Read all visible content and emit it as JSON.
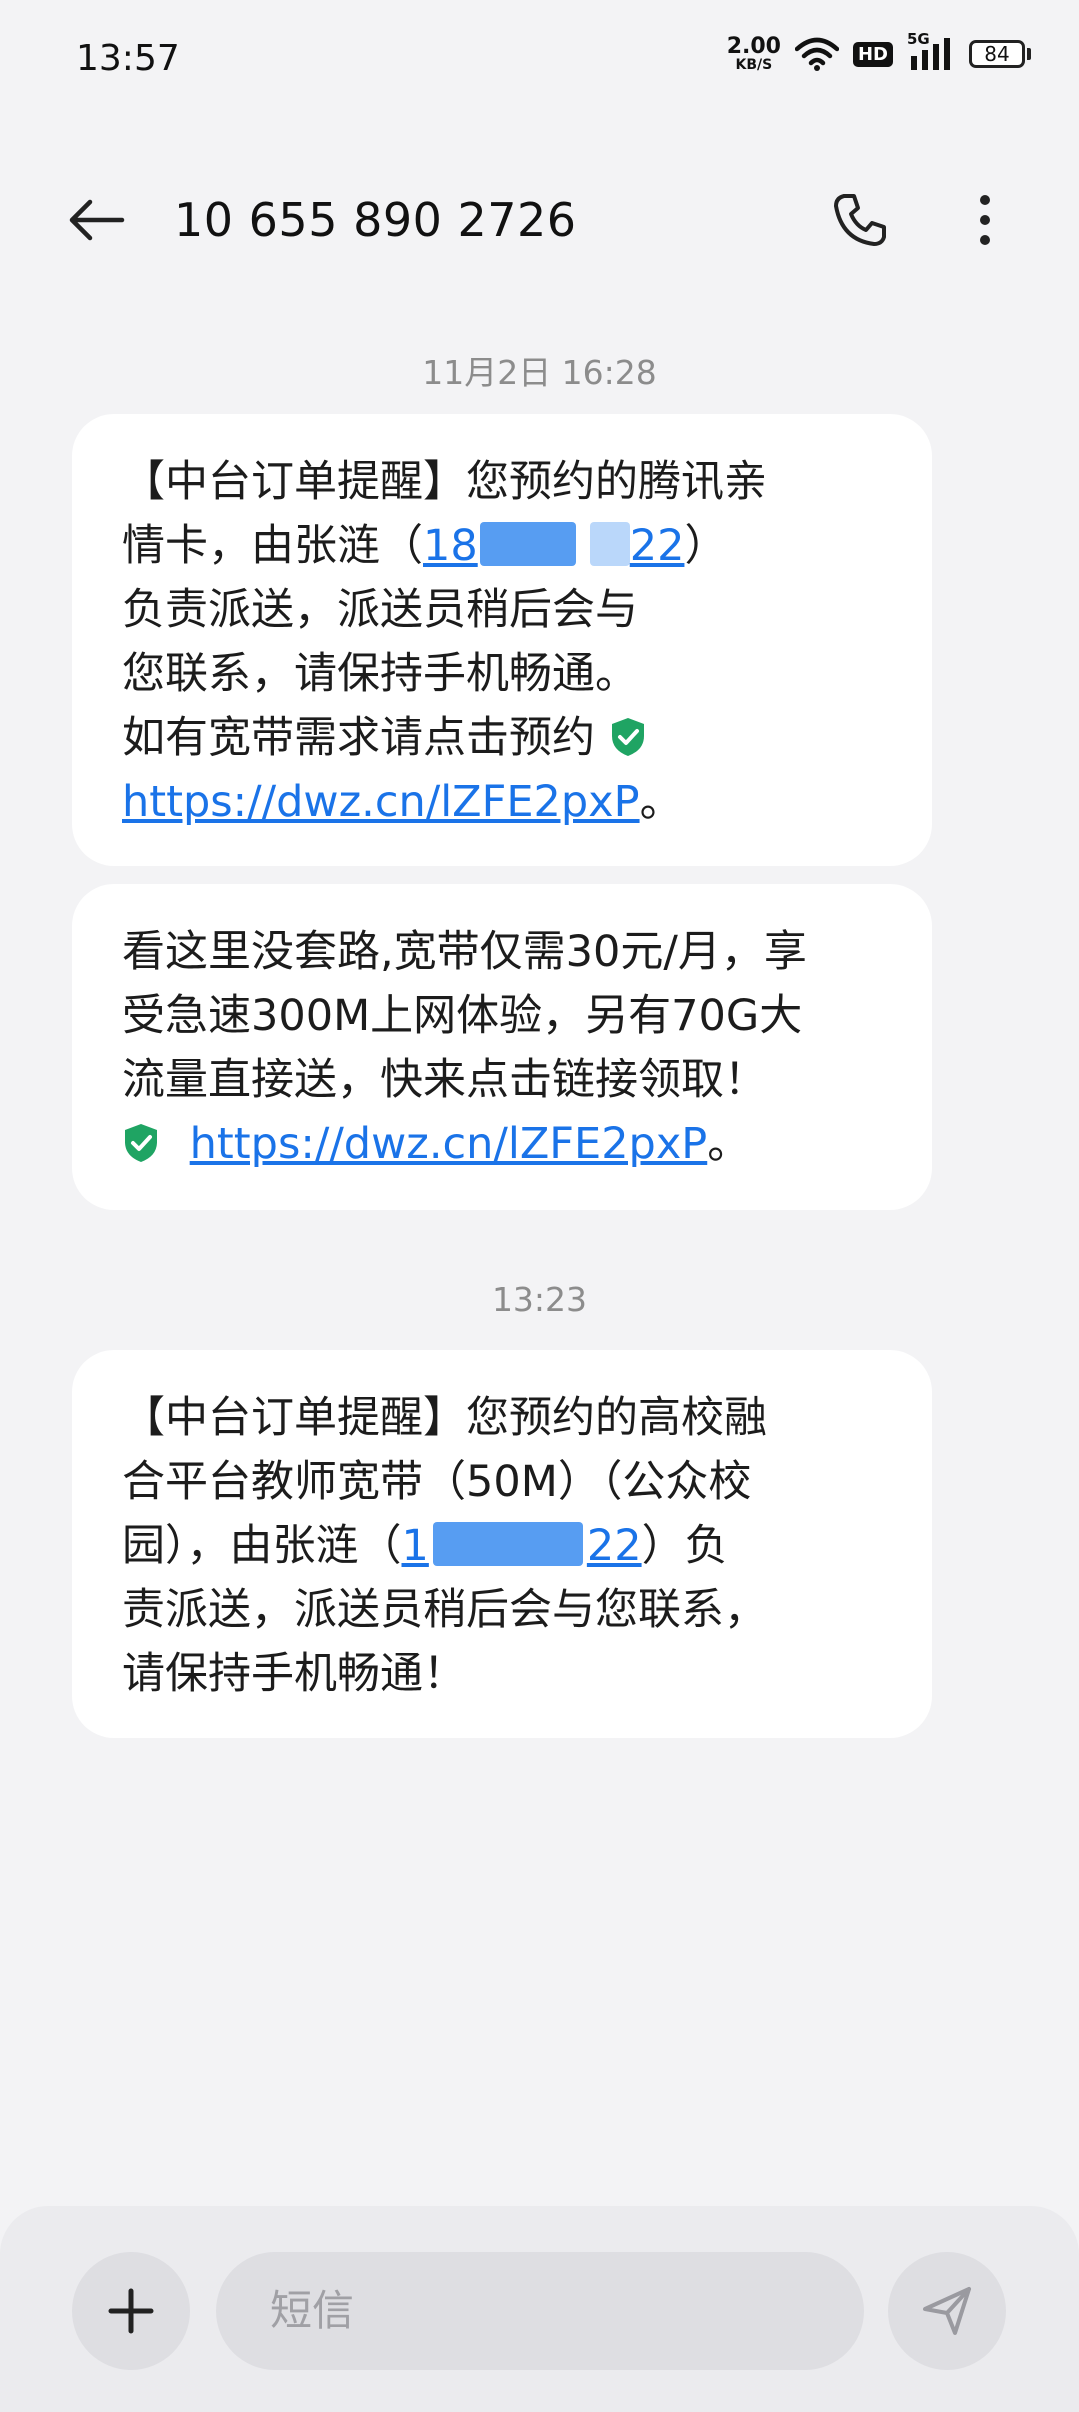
{
  "status_bar": {
    "time": "13:57",
    "net_speed_value": "2.00",
    "net_speed_unit": "KB/S",
    "hd_label": "HD",
    "network_label": "5G",
    "battery": "84"
  },
  "header": {
    "title": "10 655 890 2726",
    "icons": [
      "back-arrow-icon",
      "phone-icon",
      "more-vert-icon"
    ]
  },
  "messages": {
    "group1_time": "11月2日 16:28",
    "msg1": {
      "l1": "【中台订单提醒】您预约的腾讯亲",
      "l2_pre": "情卡，由张涟（",
      "l2_phone_a": "18",
      "l2_phone_b": "22",
      "l2_post": "）",
      "l3": "负责派送，派送员稍后会与",
      "l4": "您联系，请保持手机畅通。",
      "l5": "如有宽带需求请点击预约",
      "link": "https://dwz.cn/lZFE2pxP",
      "link_post": "。"
    },
    "msg2": {
      "l1": "看这里没套路,宽带仅需30元/月，享",
      "l2": "受急速300M上网体验，另有70G大",
      "l3": "流量直接送，快来点击链接领取！",
      "link": "https://dwz.cn/lZFE2pxP",
      "link_post": "。"
    },
    "group2_time": "13:23",
    "msg3": {
      "l1": "【中台订单提醒】您预约的高校融",
      "l2": "合平台教师宽带（50M）（公众校",
      "l3_pre": "园），由张涟（",
      "l3_phone_a": "1",
      "l3_phone_b": "22",
      "l3_post": "）负",
      "l4": "责派送，派送员稍后会与您联系，",
      "l5": "请保持手机畅通！"
    }
  },
  "composer": {
    "placeholder": "短信"
  },
  "colors": {
    "accent": "#1a73e8",
    "shield": "#1fa463",
    "background": "#f3f3f5"
  }
}
